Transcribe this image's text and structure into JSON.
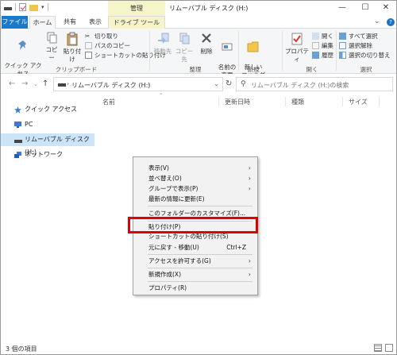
{
  "title_bar": {
    "contextual_tab": "管理",
    "window_title": "リムーバブル ディスク (H:)",
    "minimize": "—",
    "maximize": "☐",
    "close": "✕"
  },
  "ribbon_tabs": {
    "file": "ファイル",
    "home": "ホーム",
    "share": "共有",
    "view": "表示",
    "drive_tools": "ドライブ ツール"
  },
  "ribbon": {
    "clipboard": {
      "quick_access": "クイック アクセス\nにピン留めする",
      "copy": "コピー",
      "paste": "貼り付け",
      "cut": "切り取り",
      "copy_path": "パスのコピー",
      "paste_shortcut": "ショートカットの貼り付け",
      "group": "クリップボード"
    },
    "organize": {
      "move_to": "移動先",
      "copy_to": "コピー先",
      "delete": "削除",
      "rename": "名前の\n変更",
      "group": "整理"
    },
    "new": {
      "new_folder": "新しい\nフォルダー",
      "group": "新規"
    },
    "open": {
      "properties": "プロパティ",
      "open": "開く",
      "edit": "編集",
      "history": "履歴",
      "group": "開く"
    },
    "select": {
      "select_all": "すべて選択",
      "select_none": "選択解除",
      "invert": "選択の切り替え",
      "group": "選択"
    }
  },
  "address_bar": {
    "path": "リムーバブル ディスク (H:)",
    "separator": "›",
    "search_placeholder": "リムーバブル ディスク (H:)の検索"
  },
  "nav_pane": {
    "items": [
      {
        "label": "クイック アクセス"
      },
      {
        "label": "PC"
      },
      {
        "label": "リムーバブル ディスク (H:)"
      },
      {
        "label": "ネットワーク"
      }
    ]
  },
  "columns": {
    "name": "名前",
    "date": "更新日時",
    "type": "種類",
    "size": "サイズ"
  },
  "context_menu": {
    "items": [
      {
        "label": "表示(V)"
      },
      {
        "label": "並べ替え(O)"
      },
      {
        "label": "グループで表示(P)"
      },
      {
        "label": "最新の情報に更新(E)"
      },
      {
        "label": "このフォルダーのカスタマイズ(F)..."
      },
      {
        "label": "貼り付け(P)"
      },
      {
        "label": "ショートカットの貼り付け(S)"
      },
      {
        "label": "元に戻す - 移動(U)",
        "shortcut": "Ctrl+Z"
      },
      {
        "label": "アクセスを許可する(G)"
      },
      {
        "label": "新規作成(X)"
      },
      {
        "label": "プロパティ(R)"
      }
    ]
  },
  "status_bar": {
    "count": "3 個の項目"
  },
  "colors": {
    "file_tab": "#1979ca",
    "selection": "#cce4f7",
    "manage_tab": "#f6f5c9",
    "highlight": "#e00000"
  }
}
